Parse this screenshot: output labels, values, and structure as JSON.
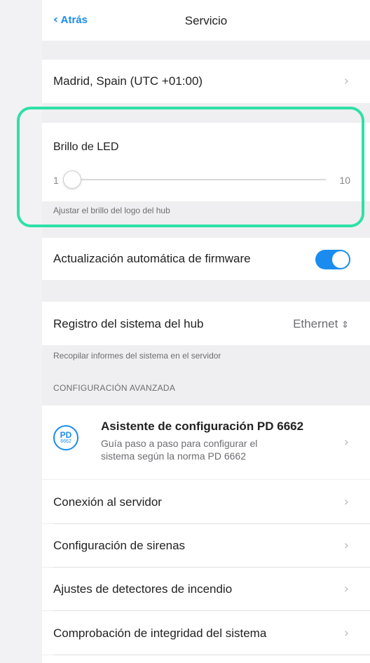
{
  "nav": {
    "back_label": "Atrás",
    "title": "Servicio"
  },
  "timezone": {
    "label": "Madrid, Spain (UTC +01:00)"
  },
  "led": {
    "label": "Brillo de LED",
    "min": "1",
    "max": "10",
    "value": 1,
    "hint": "Ajustar el brillo del logo del hub"
  },
  "firmware": {
    "label": "Actualización automática de firmware",
    "enabled": true
  },
  "syslog": {
    "label": "Registro del sistema del hub",
    "value": "Ethernet",
    "hint": "Recopilar informes del sistema en el servidor"
  },
  "advanced": {
    "header": "CONFIGURACIÓN AVANZADA",
    "wizard": {
      "icon_top": "PD",
      "icon_bottom": "6662",
      "title": "Asistente de configuración PD 6662",
      "subtitle_line1": "Guía paso a paso para configurar el",
      "subtitle_line2": "sistema según la norma PD 6662"
    },
    "items": [
      {
        "label": "Conexión al servidor"
      },
      {
        "label": "Configuración de sirenas"
      },
      {
        "label": "Ajustes de detectores de incendio"
      },
      {
        "label": "Comprobación de integridad del sistema"
      }
    ]
  },
  "colors": {
    "accent": "#1a8cf0",
    "highlight": "#2ee0a8"
  }
}
